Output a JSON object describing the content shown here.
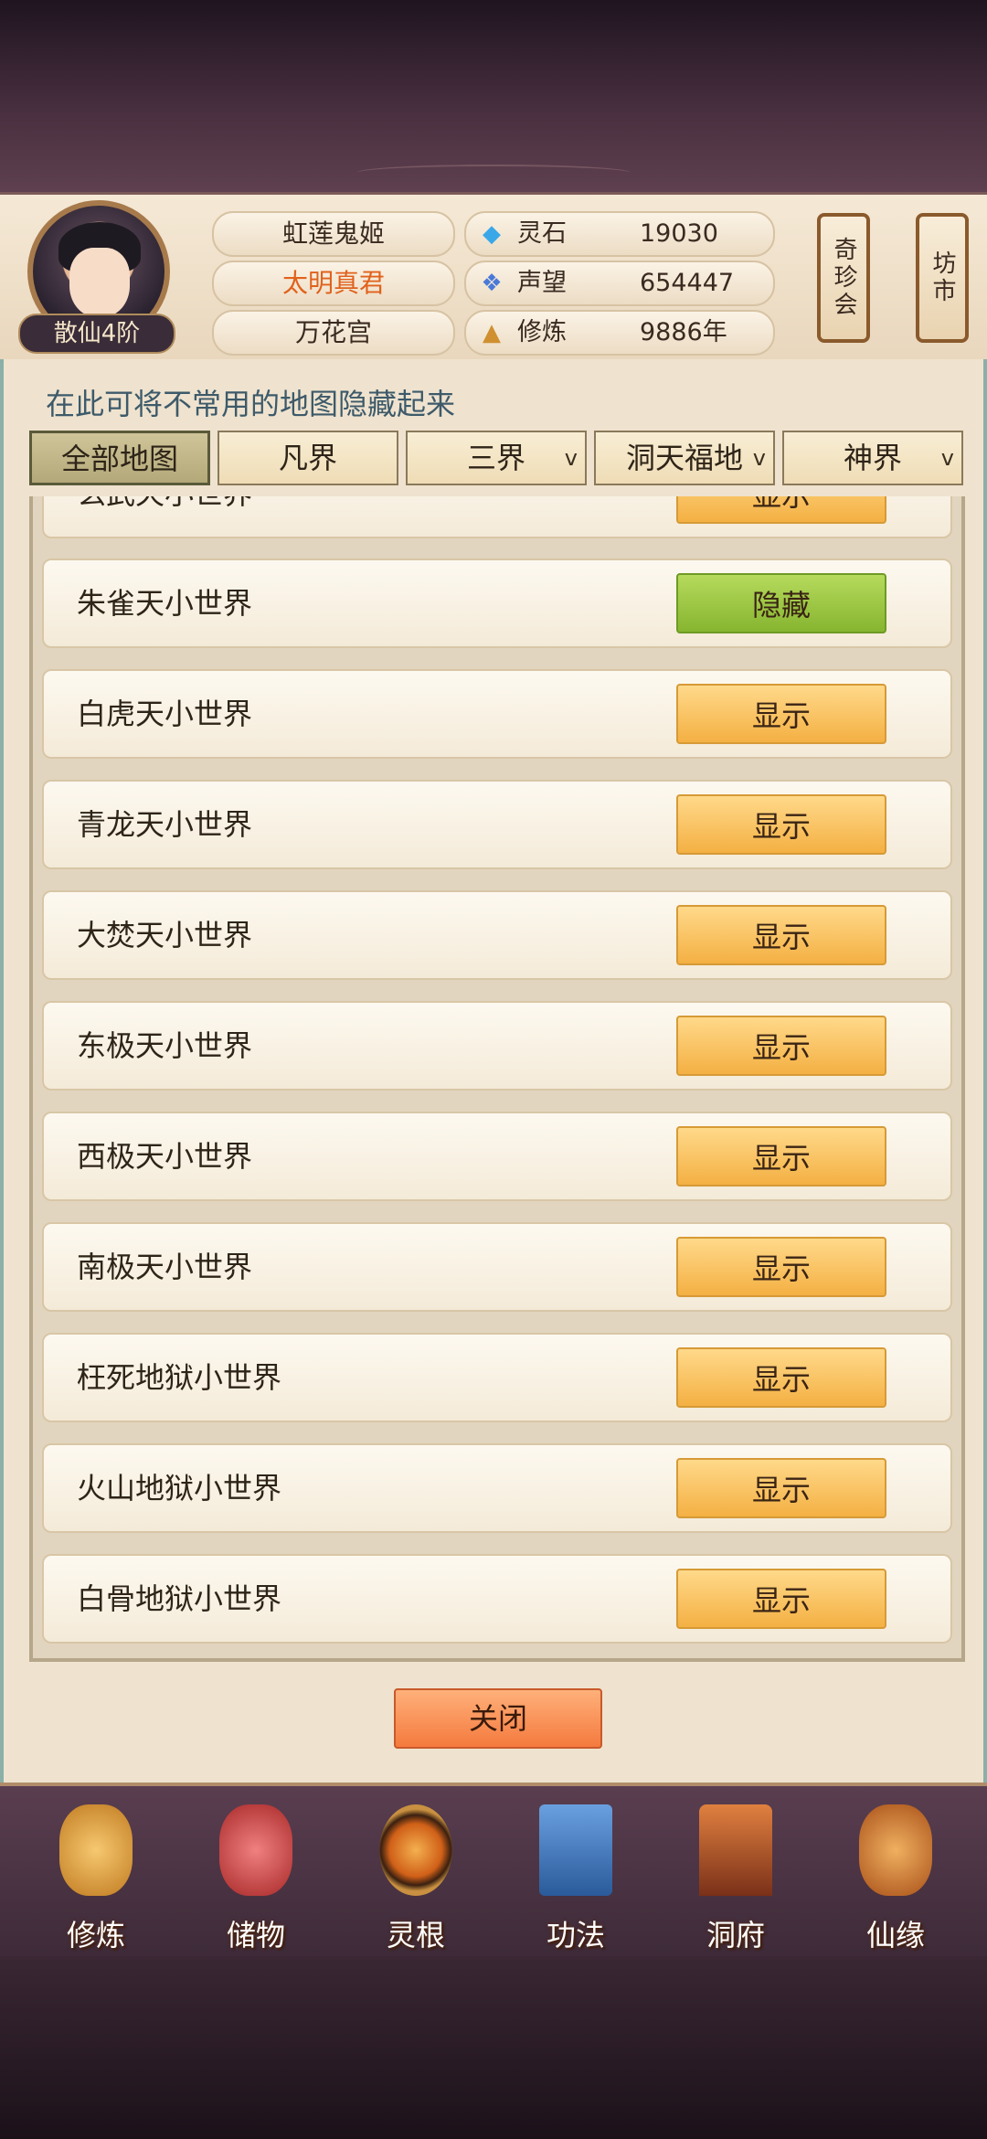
{
  "player": {
    "name": "虹莲鬼姬",
    "title": "太明真君",
    "sect": "万花宫",
    "rank": "散仙4阶"
  },
  "stats": [
    {
      "icon": "spirit-stone-icon",
      "label": "灵石",
      "value": "19030"
    },
    {
      "icon": "reputation-icon",
      "label": "声望",
      "value": "654447"
    },
    {
      "icon": "cultivation-icon",
      "label": "修炼",
      "value": "9886年"
    }
  ],
  "side_buttons": {
    "treasure": "奇珍会",
    "market": "坊市"
  },
  "panel": {
    "hint": "在此可将不常用的地图隐藏起来",
    "tabs": [
      {
        "label": "全部地图",
        "active": true,
        "dropdown": false
      },
      {
        "label": "凡界",
        "active": false,
        "dropdown": false
      },
      {
        "label": "三界",
        "active": false,
        "dropdown": true
      },
      {
        "label": "洞天福地",
        "active": false,
        "dropdown": true
      },
      {
        "label": "神界",
        "active": false,
        "dropdown": true
      }
    ],
    "chevron": "v",
    "rows": [
      {
        "label": "玄武天小世界",
        "button": "显示",
        "state": "show"
      },
      {
        "label": "朱雀天小世界",
        "button": "隐藏",
        "state": "hide"
      },
      {
        "label": "白虎天小世界",
        "button": "显示",
        "state": "show"
      },
      {
        "label": "青龙天小世界",
        "button": "显示",
        "state": "show"
      },
      {
        "label": "大焚天小世界",
        "button": "显示",
        "state": "show"
      },
      {
        "label": "东极天小世界",
        "button": "显示",
        "state": "show"
      },
      {
        "label": "西极天小世界",
        "button": "显示",
        "state": "show"
      },
      {
        "label": "南极天小世界",
        "button": "显示",
        "state": "show"
      },
      {
        "label": "枉死地狱小世界",
        "button": "显示",
        "state": "show"
      },
      {
        "label": "火山地狱小世界",
        "button": "显示",
        "state": "show"
      },
      {
        "label": "白骨地狱小世界",
        "button": "显示",
        "state": "show"
      }
    ],
    "close": "关闭"
  },
  "nav": [
    {
      "label": "修炼",
      "icon": "cultivate-icon",
      "color": "#e0a040"
    },
    {
      "label": "储物",
      "icon": "storage-bag-icon",
      "color": "#d04040"
    },
    {
      "label": "灵根",
      "icon": "spirit-root-icon",
      "color": "#c06020"
    },
    {
      "label": "功法",
      "icon": "scripture-book-icon",
      "color": "#4070b0"
    },
    {
      "label": "洞府",
      "icon": "cave-house-icon",
      "color": "#b05030"
    },
    {
      "label": "仙缘",
      "icon": "gourd-icon",
      "color": "#c07030"
    }
  ]
}
